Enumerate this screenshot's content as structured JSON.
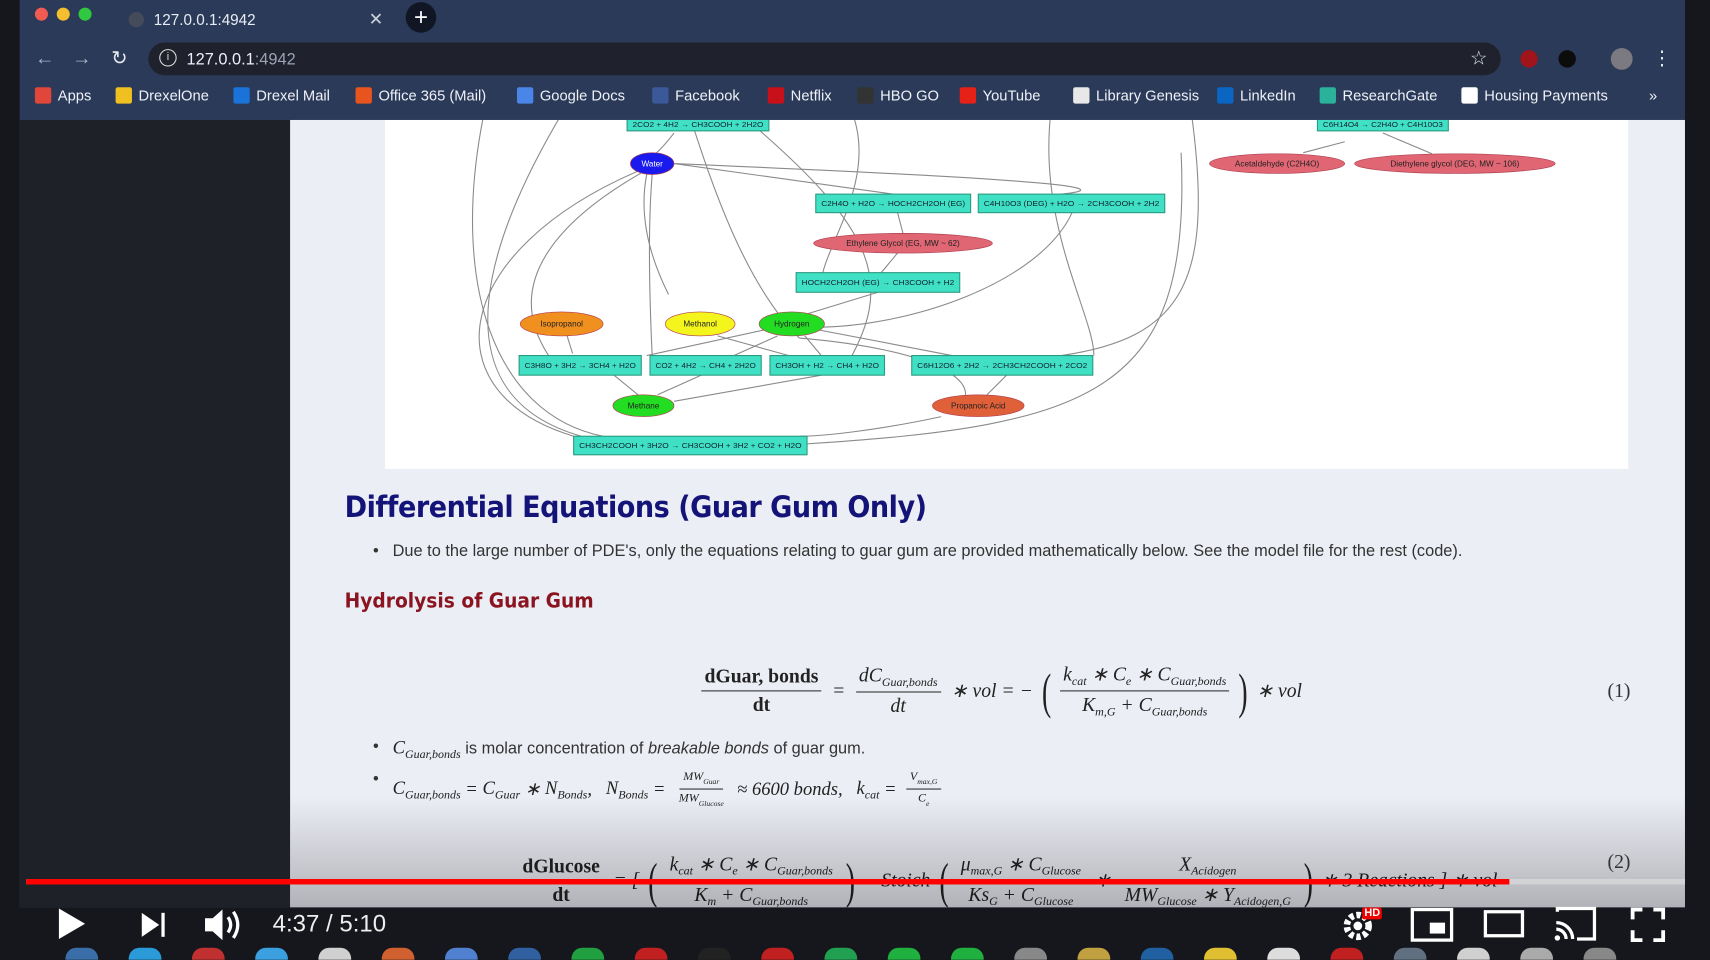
{
  "browser": {
    "tab_title": "127.0.0.1:4942",
    "url_host": "127.0.0.1",
    "url_port": ":4942",
    "bookmarks": [
      {
        "label": "Apps",
        "icon": "apps-grid-icon",
        "color": "#e0463a"
      },
      {
        "label": "DrexelOne",
        "icon": "drexelone-icon",
        "color": "#f0c020"
      },
      {
        "label": "Drexel Mail",
        "icon": "outlook-icon",
        "color": "#1a73d8"
      },
      {
        "label": "Office 365 (Mail)",
        "icon": "office365-icon",
        "color": "#e8541e"
      },
      {
        "label": "Google Docs",
        "icon": "google-docs-icon",
        "color": "#4a86e8"
      },
      {
        "label": "Facebook",
        "icon": "facebook-icon",
        "color": "#3b5998"
      },
      {
        "label": "Netflix",
        "icon": "netflix-icon",
        "color": "#c8101a"
      },
      {
        "label": "HBO GO",
        "icon": "hbo-go-icon",
        "color": "#333333"
      },
      {
        "label": "YouTube",
        "icon": "youtube-icon",
        "color": "#e62117"
      },
      {
        "label": "Library Genesis",
        "icon": "library-genesis-icon",
        "color": "#e8e8e8"
      },
      {
        "label": "LinkedIn",
        "icon": "linkedin-icon",
        "color": "#0a66c2"
      },
      {
        "label": "ResearchGate",
        "icon": "researchgate-icon",
        "color": "#2bb29a"
      },
      {
        "label": "Housing Payments",
        "icon": "housing-icon",
        "color": "#ffffff"
      }
    ],
    "more_bookmarks": "»"
  },
  "graph": {
    "reaction_color": "#40e0c4",
    "reactions": [
      {
        "id": "r1",
        "label": "2CO2 + 4H2 → CH3COOH + 2H2O"
      },
      {
        "id": "r2",
        "label": "C6H14O4 → C2H4O + C4H10O3"
      },
      {
        "id": "r3",
        "label": "C2H4O + H2O → HOCH2CH2OH (EG)"
      },
      {
        "id": "r4",
        "label": "C4H10O3 (DEG) + H2O → 2CH3COOH + 2H2"
      },
      {
        "id": "r5",
        "label": "HOCH2CH2OH (EG) → CH3COOH + H2"
      },
      {
        "id": "r6",
        "label": "C3H8O + 3H2 → 3CH4 + H2O"
      },
      {
        "id": "r7",
        "label": "CO2 + 4H2 → CH4 + 2H2O"
      },
      {
        "id": "r8",
        "label": "CH3OH + H2 → CH4 + H2O"
      },
      {
        "id": "r9",
        "label": "C6H12O6 + 2H2 → 2CH3CH2COOH + 2CO2"
      },
      {
        "id": "r10",
        "label": "CH3CH2COOH + 3H2O → CH3COOH + 3H2 + CO2 + H2O"
      }
    ],
    "species": [
      {
        "id": "water",
        "label": "Water",
        "color": "#1a1aee",
        "text": "#ffffff"
      },
      {
        "id": "acet",
        "label": "Acetaldehyde (C2H4O)",
        "color": "#e06673",
        "text": "#222222"
      },
      {
        "id": "deg",
        "label": "Diethylene glycol (DEG, MW ~ 106)",
        "color": "#e06673",
        "text": "#222222"
      },
      {
        "id": "eg",
        "label": "Ethylene Glycol (EG, MW ~ 62)",
        "color": "#e06673",
        "text": "#222222"
      },
      {
        "id": "iso",
        "label": "Isopropanol",
        "color": "#f0901e",
        "text": "#222222"
      },
      {
        "id": "meoh",
        "label": "Methanol",
        "color": "#f5f51e",
        "text": "#222222"
      },
      {
        "id": "h2",
        "label": "Hydrogen",
        "color": "#22dd22",
        "text": "#222222"
      },
      {
        "id": "ch4",
        "label": "Methane",
        "color": "#22dd22",
        "text": "#222222"
      },
      {
        "id": "prop",
        "label": "Propanoic Acid",
        "color": "#e0603a",
        "text": "#222222"
      }
    ]
  },
  "doc": {
    "heading": "Differential Equations (Guar Gum Only)",
    "intro": "Due to the large number of PDE's, only the equations relating to guar gum are provided mathematically below. See the model file for the rest (code).",
    "subheading": "Hydrolysis of Guar Gum",
    "eq1_number": "(1)",
    "eq2_number": "(2)",
    "bullet1_rest_a": " is molar concentration of ",
    "bullet1_italic": "breakable bonds",
    "bullet1_rest_b": " of guar gum.",
    "eq1": [
      {
        "frac": [
          [
            {
              "bold": "dGuar, bonds"
            }
          ],
          [
            {
              "bold": "dt"
            }
          ]
        ]
      },
      " = ",
      {
        "frac": [
          [
            "d",
            {
              "b": "C",
              "s": "Guar,bonds"
            }
          ],
          [
            "dt"
          ]
        ]
      },
      " ∗ vol = − ",
      {
        "paren": [
          {
            "frac": [
              [
                {
                  "b": "k",
                  "s": "cat"
                },
                " ∗ ",
                {
                  "b": "C",
                  "s": "e"
                },
                " ∗ ",
                {
                  "b": "C",
                  "s": "Guar,bonds"
                }
              ],
              [
                {
                  "b": "K",
                  "s": "m,G"
                },
                " + ",
                {
                  "b": "C",
                  "s": "Guar,bonds"
                }
              ]
            ]
          }
        ]
      },
      " ∗ vol"
    ],
    "bullet1_math": [
      {
        "b": "C",
        "s": "Guar,bonds"
      }
    ],
    "bullet2_math": [
      {
        "b": "C",
        "s": "Guar,bonds"
      },
      " = ",
      {
        "b": "C",
        "s": "Guar"
      },
      " ∗ ",
      {
        "b": "N",
        "s": "Bonds"
      },
      ",   ",
      {
        "b": "N",
        "s": "Bonds"
      },
      " = ",
      {
        "small": [
          [
            {
              "b": "MW",
              "s": "Guar"
            }
          ],
          [
            {
              "b": "MW",
              "s": "Glucose"
            }
          ]
        ]
      },
      " ≈ 6600 bonds,   ",
      {
        "b": "k",
        "s": "cat"
      },
      " = ",
      {
        "small": [
          [
            {
              "b": "V",
              "s": "max,G"
            }
          ],
          [
            {
              "b": "C",
              "s": "e"
            }
          ]
        ]
      }
    ],
    "eq2": [
      {
        "frac": [
          [
            {
              "bold": "dGlucose"
            }
          ],
          [
            {
              "bold": "dt"
            }
          ]
        ]
      },
      " = [ ",
      {
        "paren": [
          {
            "frac": [
              [
                {
                  "b": "k",
                  "s": "cat"
                },
                " ∗ ",
                {
                  "b": "C",
                  "s": "e"
                },
                " ∗ ",
                {
                  "b": "C",
                  "s": "Guar,bonds"
                }
              ],
              [
                {
                  "b": "K",
                  "s": "m"
                },
                " + ",
                {
                  "b": "C",
                  "s": "Guar,bonds"
                }
              ]
            ]
          }
        ]
      },
      " − Stoich ",
      {
        "paren": [
          {
            "frac": [
              [
                {
                  "b": "μ",
                  "s": "max,G"
                },
                " ∗ ",
                {
                  "b": "C",
                  "s": "Glucose"
                }
              ],
              [
                {
                  "b": "Ks",
                  "s": "G"
                },
                " + ",
                {
                  "b": "C",
                  "s": "Glucose"
                }
              ]
            ]
          },
          " ∗ ",
          {
            "frac": [
              [
                {
                  "b": "X",
                  "s": "Acidogen"
                }
              ],
              [
                {
                  "b": "MW",
                  "s": "Glucose"
                },
                " ∗ ",
                {
                  "b": "Y",
                  "s": "Acidogen,G"
                }
              ]
            ]
          }
        ]
      },
      " ∗ 3 Reactions ] ∗ vol"
    ]
  },
  "player": {
    "time_current": "4:37",
    "time_separator": " / ",
    "time_total": "5:10",
    "progress_fraction": 0.894,
    "hd_badge": "HD",
    "progress_color": "#ff0000"
  }
}
